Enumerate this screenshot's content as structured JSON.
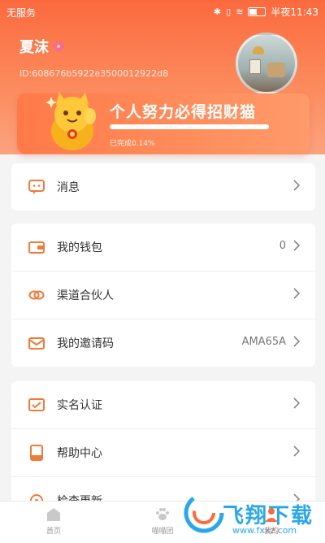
{
  "status_bar": {
    "carrier": "无服务",
    "time": "半夜11:43"
  },
  "profile": {
    "name": "夏沫",
    "id_text": "ID:608676b5922e3500012922d8"
  },
  "promo": {
    "title": "个人努力必得招财猫",
    "progress_text": "已完成0.14%",
    "progress_percent": 0.14
  },
  "menu_groups": [
    [
      {
        "label": "消息",
        "value": "",
        "icon": "message-icon"
      }
    ],
    [
      {
        "label": "我的钱包",
        "value": "0",
        "icon": "wallet-icon"
      },
      {
        "label": "渠道合伙人",
        "value": "",
        "icon": "link-icon"
      },
      {
        "label": "我的邀请码",
        "value": "AMA65A",
        "icon": "envelope-icon"
      }
    ],
    [
      {
        "label": "实名认证",
        "value": "",
        "icon": "id-card-icon"
      },
      {
        "label": "帮助中心",
        "value": "",
        "icon": "book-icon"
      },
      {
        "label": "检查更新",
        "value": "",
        "icon": "update-icon"
      }
    ]
  ],
  "tabs": [
    {
      "label": "首页",
      "icon": "home-icon",
      "active": false
    },
    {
      "label": "喵喵团",
      "icon": "paw-icon",
      "active": false
    },
    {
      "label": "",
      "icon": "",
      "active": false
    },
    {
      "label": "我的",
      "icon": "user-icon",
      "active": true
    }
  ],
  "watermark": {
    "text": "飞翔下载",
    "url": "www.fxxz.com"
  },
  "colors": {
    "accent": "#fb6a3e",
    "icon_orange": "#f07a3a"
  }
}
